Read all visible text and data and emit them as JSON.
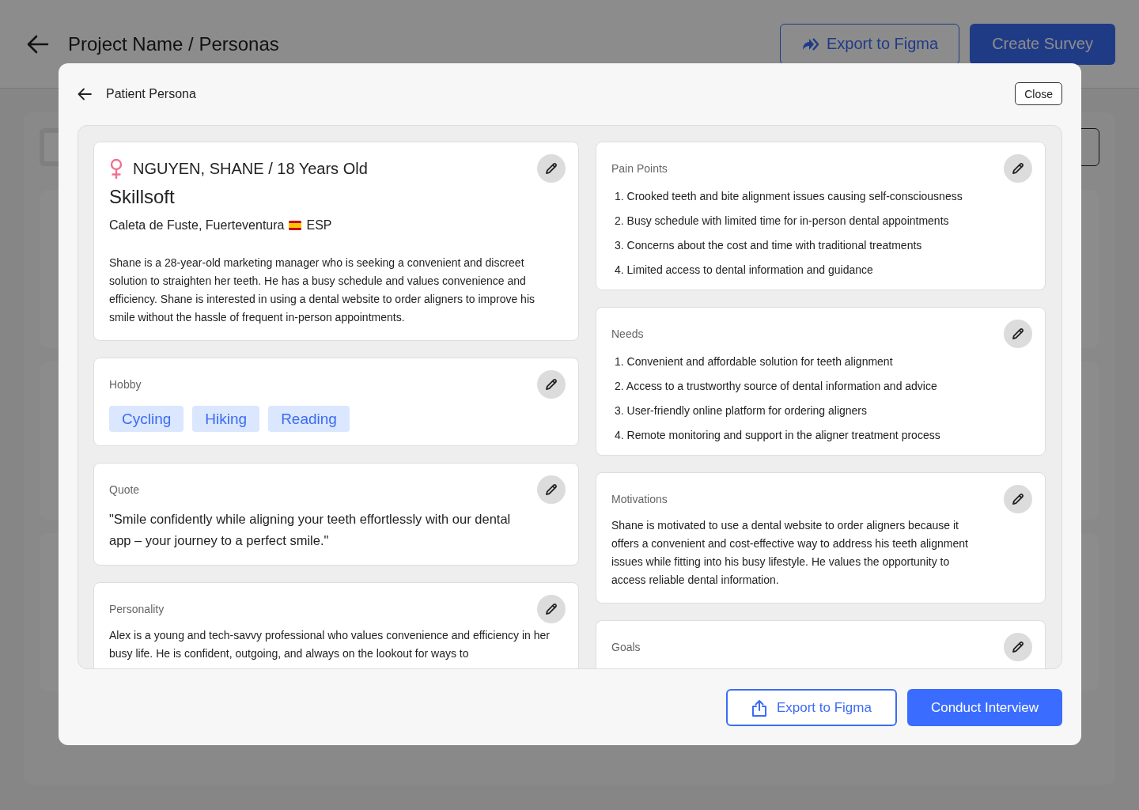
{
  "page": {
    "title": "Project Name / Personas",
    "buttons": [
      {
        "label": "Export to Figma",
        "kind": "outline"
      },
      {
        "label": "Create Survey",
        "kind": "primary"
      }
    ]
  },
  "modal": {
    "title": "Patient Persona",
    "close": "Close",
    "profile": {
      "name_line": "NGUYEN, SHANE / 18 Years Old",
      "company": "Skillsoft",
      "location": "Caleta de Fuste, Fuerteventura",
      "country": "ESP",
      "bio": "Shane is a 28-year-old marketing manager who is seeking a convenient and discreet solution to straighten her teeth. He has a busy schedule and values convenience and efficiency. Shane is interested in using a dental website to order aligners to improve his smile without the hassle of frequent in-person appointments."
    },
    "left_sections": [
      {
        "kind": "tags",
        "title": "Hobby",
        "tags": [
          "Cycling",
          "Hiking",
          "Reading"
        ]
      },
      {
        "kind": "quote",
        "title": "Quote",
        "text": "\"Smile confidently while aligning your teeth effortlessly with our dental app – your journey to a perfect smile.\""
      },
      {
        "kind": "text",
        "title": "Personality",
        "text": "Alex is a young and tech-savvy professional who values convenience and efficiency in her busy life. He is confident, outgoing, and always on the lookout for ways to"
      }
    ],
    "right_sections": [
      {
        "kind": "list",
        "title": "Pain Points",
        "items": [
          "1. Crooked teeth and bite alignment issues causing self-consciousness",
          "2. Busy schedule with limited time for in-person dental appointments",
          "3. Concerns about the cost and time with traditional treatments",
          "4. Limited access to dental information and guidance"
        ]
      },
      {
        "kind": "list",
        "title": "Needs",
        "items": [
          "1. Convenient and affordable solution for teeth alignment",
          "2. Access to a trustworthy source of dental information and advice",
          "3. User-friendly online platform for ordering aligners",
          "4. Remote monitoring and support in the aligner treatment process"
        ]
      },
      {
        "kind": "text",
        "title": "Motivations",
        "text": "Shane is motivated to use a dental website to order aligners because it offers a convenient and cost-effective way to address his teeth alignment issues while fitting into his busy lifestyle. He values the opportunity to access reliable dental information."
      },
      {
        "kind": "text",
        "title": "Goals"
      }
    ],
    "footer": [
      {
        "label": "Export to Figma",
        "kind": "outline"
      },
      {
        "label": "Conduct Interview",
        "kind": "primary"
      }
    ]
  }
}
